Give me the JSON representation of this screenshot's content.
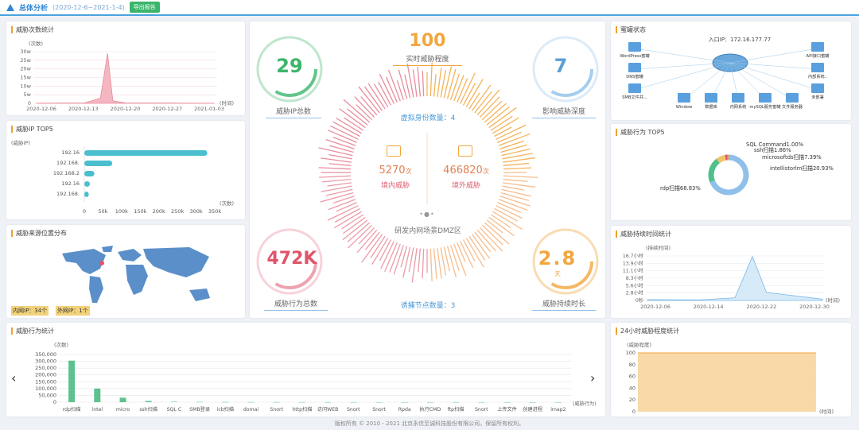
{
  "header": {
    "title": "总体分析",
    "range": "(2020-12-6~2021-1-4)",
    "export_label": "导出报告"
  },
  "attack_count": {
    "title": "威胁次数统计",
    "unit": "(次数)",
    "time_unit": "(时间)",
    "y_ticks": [
      "0",
      "5w",
      "10w",
      "15w",
      "20w",
      "25w",
      "30w"
    ],
    "x_ticks": [
      "2020-12-06",
      "2020-12-13",
      "2020-12-20",
      "2020-12-27",
      "2021-01-03"
    ]
  },
  "ip_top5": {
    "title": "威胁IP TOP5",
    "unit": "(威胁IP)",
    "x_unit": "(次数)",
    "labels": [
      "192.16",
      "192.168.",
      "192.168.2",
      "192.16",
      "192.168."
    ],
    "x_ticks": [
      "0",
      "50k",
      "100k",
      "150k",
      "200k",
      "250k",
      "300k",
      "350k"
    ]
  },
  "geo": {
    "title": "威胁来源位置分布",
    "inner_label": "内网IP：34个",
    "outer_label": "外网IP：1个"
  },
  "center": {
    "real_level": "100",
    "real_level_label": "实时威胁程度",
    "ip_total": "29",
    "ip_total_label": "威胁IP总数",
    "depth": "7",
    "depth_label": "影响威胁深度",
    "behavior_total": "472K",
    "behavior_total_label": "威胁行为总数",
    "duration": "2.8",
    "duration_unit": "天",
    "duration_label": "威胁持续时长",
    "virtual_count": "虚拟身份数量：4",
    "inner_value": "5270",
    "inner_unit": "次",
    "inner_label": "境内威胁",
    "outer_value": "466820",
    "outer_unit": "次",
    "outer_label": "境外威胁",
    "scene": "研发内网场景DMZ区",
    "bait_count": "诱捕节点数量：3"
  },
  "honey": {
    "title": "蜜罐状态",
    "entry": "入口IP：172.16.177.77",
    "nodes_left": [
      "WordPress蜜罐",
      "DNS蜜罐",
      "SMB文件共..."
    ],
    "nodes_bottom": [
      "Window",
      "数据库",
      "内网系统",
      "mySQL服务蜜罐",
      "文件服务器"
    ],
    "nodes_right": [
      "API接口蜜罐",
      "内部系统..",
      "未部署"
    ]
  },
  "behavior_top5": {
    "title": "威胁行为 TOP5",
    "labels": [
      "SQL Command1.00%",
      "ssh扫描1.86%",
      "microsoftds扫描7.39%",
      "intellistorlm扫描20.93%",
      "rdp扫描68.83%"
    ]
  },
  "duration_chart": {
    "title": "威胁持续时间统计",
    "unit": "(持续时间)",
    "time_unit": "(时间)",
    "y_ticks": [
      "0秒",
      "2.8小时",
      "5.6小时",
      "8.3小时",
      "11.1小时",
      "13.9小时",
      "16.7小时"
    ],
    "x_ticks": [
      "2020-12-06",
      "2020-12-14",
      "2020-12-22",
      "2020-12-30"
    ]
  },
  "behavior_stats": {
    "title": "威胁行为统计",
    "unit": "(次数)",
    "x_unit": "(威胁行为)",
    "y_ticks": [
      "0",
      "50,000",
      "100,000",
      "150,000",
      "200,000",
      "250,000",
      "300,000",
      "350,000"
    ],
    "categories": [
      "rdp扫描",
      "intel",
      "micro",
      "ssh扫描",
      "SQL C",
      "SMB登录",
      "icb扫描",
      "domai",
      "Snort",
      "http扫描",
      "访问WEB",
      "Snort",
      "Snort",
      "Rpda",
      "执行CMD",
      "ftp扫描",
      "Snort",
      "上传文件",
      "创建进程",
      "imap2"
    ]
  },
  "hourly": {
    "title": "24小时威胁程度统计",
    "unit": "(威胁程度)",
    "time_unit": "(时间)",
    "y_ticks": [
      "0",
      "20",
      "40",
      "60",
      "80",
      "100"
    ]
  },
  "footer": "版权所有 © 2010 - 2021 北京永信至诚科技股份有限公司。保留所有权利。",
  "colors": {
    "accent": "#2f86d6",
    "green": "#3bb56b",
    "pink": "#e88a9a",
    "teal": "#4bbfce",
    "orange": "#f2a63d",
    "red": "#e0546a",
    "blue": "#8fc0ea"
  },
  "chart_data": [
    {
      "type": "area",
      "title": "威胁次数统计",
      "x": [
        "2020-12-06",
        "2020-12-13",
        "2020-12-15",
        "2020-12-16",
        "2020-12-17",
        "2020-12-20",
        "2020-12-27",
        "2021-01-03"
      ],
      "values": [
        1000,
        2000,
        30000,
        290000,
        15000,
        2000,
        1500,
        1000
      ],
      "ylim": [
        0,
        300000
      ]
    },
    {
      "type": "bar",
      "title": "威胁IP TOP5",
      "categories": [
        "192.16",
        "192.168.",
        "192.168.2",
        "192.16",
        "192.168."
      ],
      "values": [
        330000,
        75000,
        27000,
        15000,
        12000
      ],
      "xlim": [
        0,
        350000
      ]
    },
    {
      "type": "pie",
      "title": "威胁行为 TOP5",
      "categories": [
        "SQL Command",
        "ssh扫描",
        "microsoftds扫描",
        "intellistorlm扫描",
        "rdp扫描"
      ],
      "values": [
        1.0,
        1.86,
        7.39,
        20.93,
        68.83
      ]
    },
    {
      "type": "area",
      "title": "威胁持续时间统计",
      "x": [
        "2020-12-06",
        "2020-12-14",
        "2020-12-20",
        "2020-12-22",
        "2020-12-24",
        "2020-12-30"
      ],
      "values": [
        0.3,
        0.2,
        1.0,
        16.5,
        3.0,
        0.5
      ],
      "ylim": [
        0,
        16.7
      ]
    },
    {
      "type": "bar",
      "title": "威胁行为统计",
      "categories": [
        "rdp扫描",
        "intel",
        "micro",
        "ssh扫描",
        "SQL C",
        "SMB登录",
        "icb扫描",
        "domai",
        "Snort",
        "http扫描",
        "访问WEB",
        "Snort",
        "Snort",
        "Rpda",
        "执行CMD",
        "ftp扫描",
        "Snort",
        "上传文件",
        "创建进程",
        "imap2"
      ],
      "values": [
        305000,
        100000,
        33000,
        9000,
        3000,
        2000,
        1500,
        1000,
        800,
        700,
        600,
        500,
        500,
        400,
        400,
        300,
        300,
        300,
        200,
        200
      ],
      "ylim": [
        0,
        350000
      ]
    },
    {
      "type": "area",
      "title": "24小时威胁程度统计",
      "values": [
        100,
        100,
        100,
        100,
        100,
        100,
        100,
        100,
        100,
        100,
        100,
        100,
        100,
        100,
        100,
        100,
        100,
        100,
        100,
        100,
        100,
        100,
        100,
        100
      ],
      "ylim": [
        0,
        100
      ]
    }
  ]
}
